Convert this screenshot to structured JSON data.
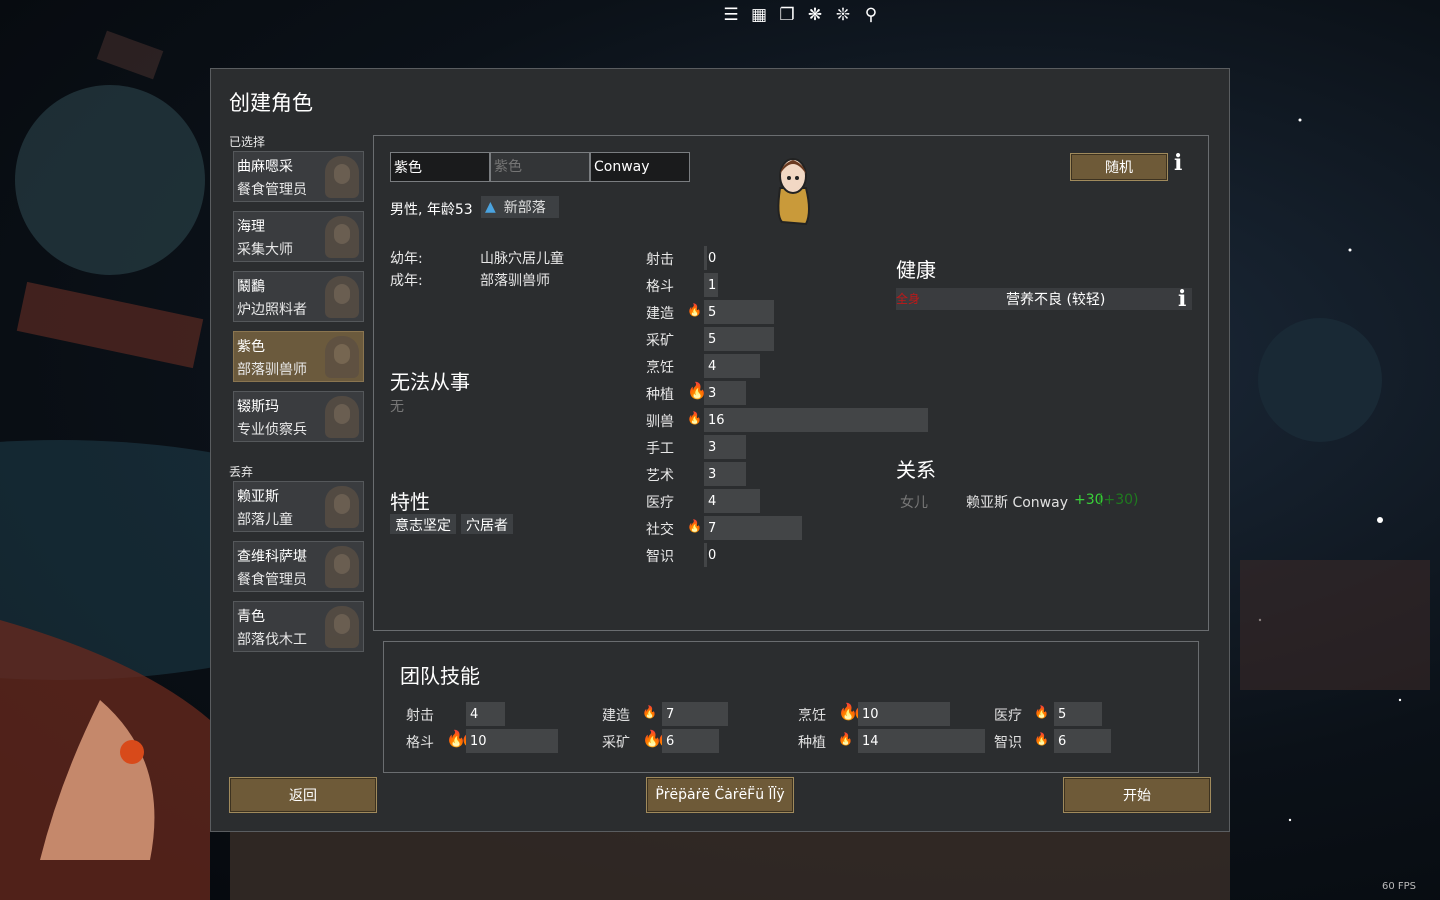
{
  "toolbar": {
    "icons": [
      "notes-icon",
      "table-icon",
      "copy-icon",
      "snowflake-icon",
      "snowflake-alt-icon",
      "search-icon"
    ]
  },
  "fps": "60 FPS",
  "window": {
    "title": "创建角色"
  },
  "roster": {
    "selected_label": "已选择",
    "discarded_label": "丢弃",
    "selected": [
      {
        "name": "曲麻嗯采",
        "title": "餐食管理员"
      },
      {
        "name": "海理",
        "title": "采集大师"
      },
      {
        "name": "鬫鷭",
        "title": "炉边照料者"
      },
      {
        "name": "紫色",
        "title": "部落驯兽师",
        "active": true
      },
      {
        "name": "辍斯玛",
        "title": "专业侦察兵"
      }
    ],
    "discarded": [
      {
        "name": "赖亚斯",
        "title": "部落儿童"
      },
      {
        "name": "查维科萨堪",
        "title": "餐食管理员"
      },
      {
        "name": "青色",
        "title": "部落伐木工"
      }
    ]
  },
  "pawn": {
    "first_name": "紫色",
    "nick_placeholder": "紫色",
    "last_name": "Conway",
    "gender_age": "男性, 年龄53",
    "faction": "新部落",
    "randomize": "随机",
    "childhood_label": "幼年:",
    "childhood": "山脉穴居儿童",
    "adulthood_label": "成年:",
    "adulthood": "部落驯兽师",
    "incapable_heading": "无法从事",
    "incapable": "无",
    "traits_heading": "特性",
    "traits": [
      "意志坚定",
      "穴居者"
    ],
    "health_heading": "健康",
    "health": {
      "part": "全身",
      "condition": "营养不良 (较轻)"
    },
    "relations_heading": "关系",
    "relations": [
      {
        "type": "女儿",
        "name": "赖亚斯 Conway",
        "opinion": "+30",
        "opinion_paren": "(+30)"
      }
    ],
    "skills": [
      {
        "name": "射击",
        "value": 0,
        "passion": 0
      },
      {
        "name": "格斗",
        "value": 1,
        "passion": 0
      },
      {
        "name": "建造",
        "value": 5,
        "passion": 1
      },
      {
        "name": "采矿",
        "value": 5,
        "passion": 0
      },
      {
        "name": "烹饪",
        "value": 4,
        "passion": 0
      },
      {
        "name": "种植",
        "value": 3,
        "passion": 2
      },
      {
        "name": "驯兽",
        "value": 16,
        "passion": 1
      },
      {
        "name": "手工",
        "value": 3,
        "passion": 0
      },
      {
        "name": "艺术",
        "value": 3,
        "passion": 0
      },
      {
        "name": "医疗",
        "value": 4,
        "passion": 0
      },
      {
        "name": "社交",
        "value": 7,
        "passion": 1
      },
      {
        "name": "智识",
        "value": 0,
        "passion": 0
      }
    ]
  },
  "team": {
    "title": "团队技能",
    "skills": [
      {
        "name": "射击",
        "value": 4,
        "passion": 0
      },
      {
        "name": "格斗",
        "value": 10,
        "passion": 2
      },
      {
        "name": "建造",
        "value": 7,
        "passion": 1
      },
      {
        "name": "采矿",
        "value": 6,
        "passion": 2
      },
      {
        "name": "烹饪",
        "value": 10,
        "passion": 2
      },
      {
        "name": "种植",
        "value": 14,
        "passion": 1
      },
      {
        "name": "医疗",
        "value": 5,
        "passion": 1
      },
      {
        "name": "智识",
        "value": 6,
        "passion": 1
      }
    ]
  },
  "buttons": {
    "back": "返回",
    "prepare": "P̈ṙëp̈ȧṙë C̈ȧṙëF̈ü l̈l̈ÿ",
    "start": "开始"
  }
}
